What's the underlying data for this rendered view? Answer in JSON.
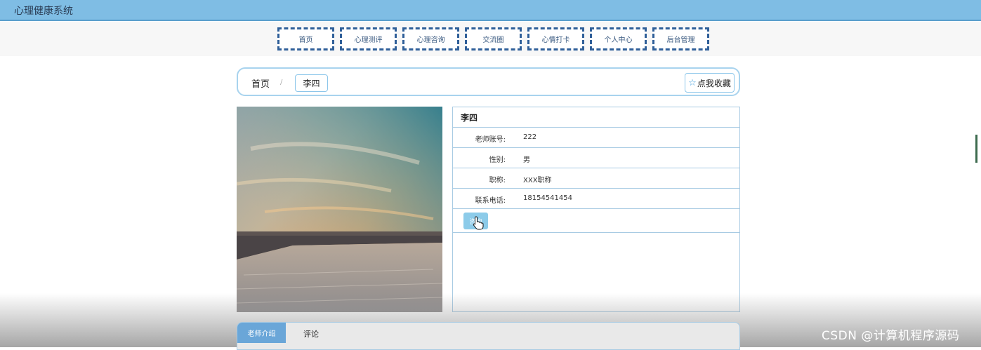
{
  "app": {
    "title": "心理健康系统"
  },
  "nav": {
    "items": [
      "首页",
      "心理测评",
      "心理咨询",
      "交流圈",
      "心情打卡",
      "个人中心",
      "后台管理"
    ]
  },
  "breadcrumb": {
    "home": "首页",
    "separator": "/",
    "current": "李四"
  },
  "favorite": {
    "label": "点我收藏",
    "icon": "star-icon"
  },
  "teacher": {
    "name": "李四",
    "fields": [
      {
        "label": "老师账号:",
        "value": "222"
      },
      {
        "label": "性别:",
        "value": "男"
      },
      {
        "label": "职称:",
        "value": "XXX职称"
      },
      {
        "label": "联系电话:",
        "value": "18154541454"
      }
    ],
    "consult_label": "咨询"
  },
  "tabs": {
    "active": "老师介绍",
    "other": "评论"
  },
  "watermark": "CSDN @计算机程序源码",
  "colors": {
    "topbar": "#7fbde4",
    "nav_border": "#2f5f99",
    "accent": "#8ccbe9",
    "tab_active": "#6aa6d8"
  }
}
